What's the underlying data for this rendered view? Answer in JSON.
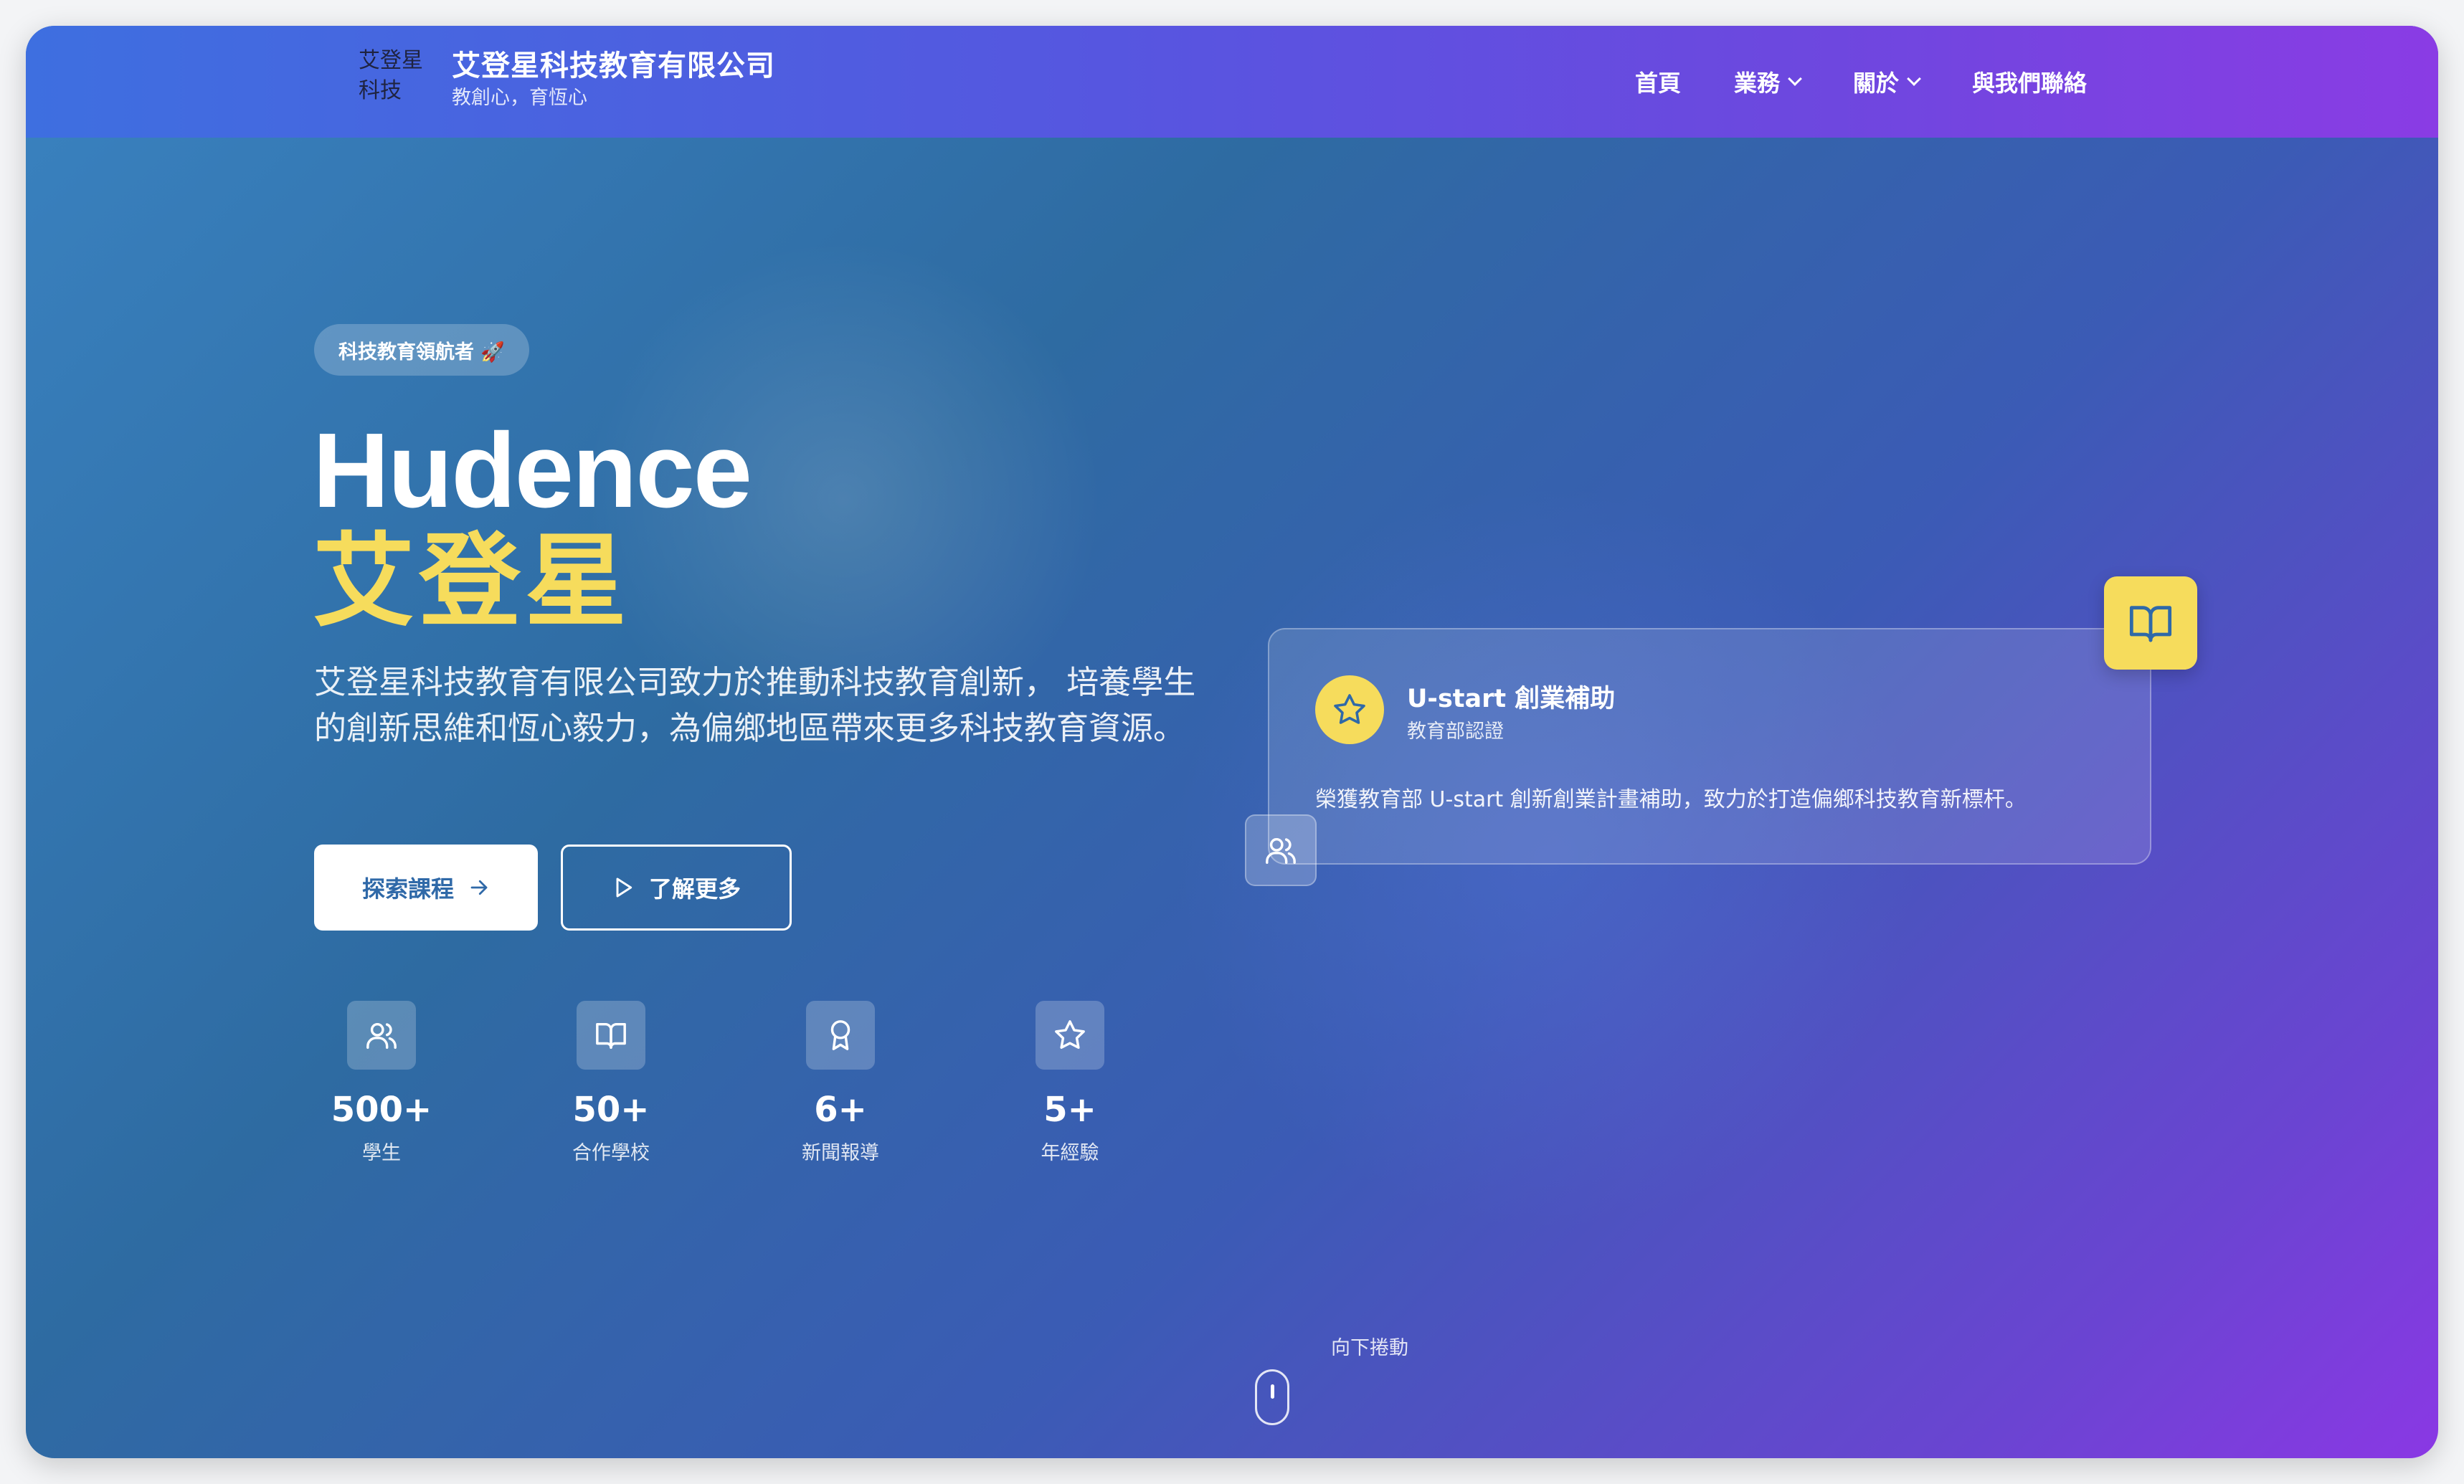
{
  "nav": {
    "logo_alt": "艾登星科技",
    "brand_title": "艾登星科技教育有限公司",
    "brand_subtitle": "教創心，育恆心",
    "items": [
      {
        "label": "首頁",
        "dropdown": false
      },
      {
        "label": "業務",
        "dropdown": true
      },
      {
        "label": "關於",
        "dropdown": true
      },
      {
        "label": "與我們聯絡",
        "dropdown": false
      }
    ]
  },
  "hero": {
    "badge": "科技教育領航者 🚀",
    "title_en": "Hudence",
    "title_zh": "艾登星",
    "description": "艾登星科技教育有限公司致力於推動科技教育創新， 培養學生的創新思維和恆心毅力，為偏鄉地區帶來更多科技教育資源。",
    "primary_button": "探索課程",
    "secondary_button": "了解更多"
  },
  "stats": [
    {
      "icon": "users-icon",
      "value": "500+",
      "label": "學生"
    },
    {
      "icon": "book-icon",
      "value": "50+",
      "label": "合作學校"
    },
    {
      "icon": "award-icon",
      "value": "6+",
      "label": "新聞報導"
    },
    {
      "icon": "star-icon",
      "value": "5+",
      "label": "年經驗"
    }
  ],
  "card": {
    "title": "U-start 創業補助",
    "subtitle": "教育部認證",
    "description": "榮獲教育部 U-start 創新創業計畫補助，致力於打造偏鄉科技教育新標杆。"
  },
  "scroll": {
    "label": "向下捲動"
  },
  "colors": {
    "accent_yellow": "#f6dc5c",
    "nav_start": "#3e6fe0",
    "nav_end": "#8a3ce4",
    "primary_text": "#2f69a8"
  }
}
